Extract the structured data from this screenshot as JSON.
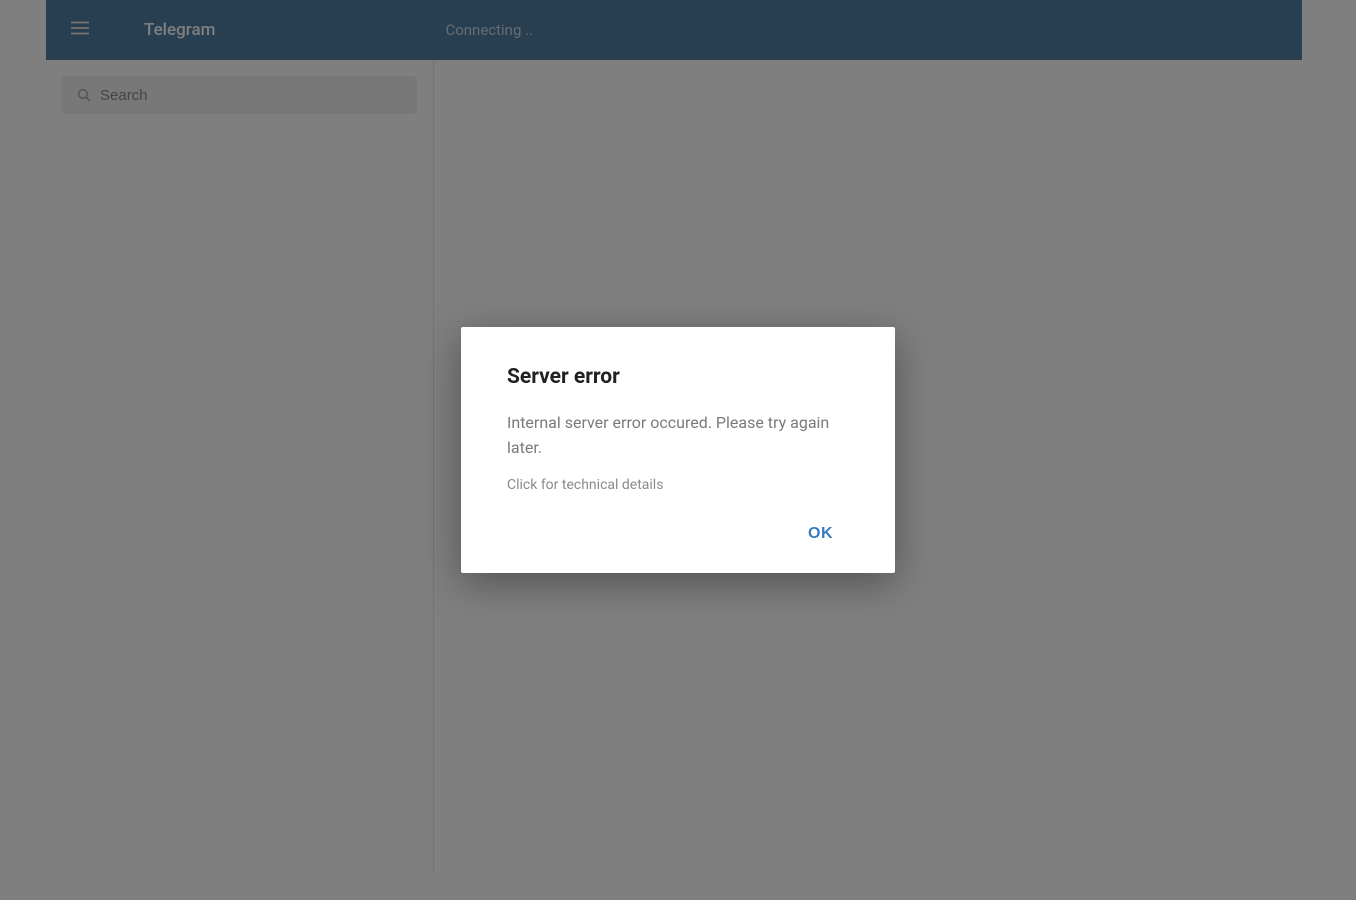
{
  "header": {
    "app_title": "Telegram",
    "connecting_status": "Connecting .."
  },
  "search": {
    "placeholder": "Search",
    "value": ""
  },
  "dialog": {
    "title": "Server error",
    "message": "Internal server error occured. Please try again later.",
    "details_link": "Click for technical details",
    "ok_label": "OK"
  }
}
